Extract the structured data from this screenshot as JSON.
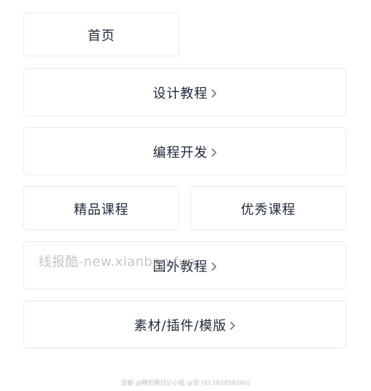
{
  "menu": {
    "home": "首页",
    "design_tutorial": "设计教程",
    "programming_dev": "编程开发",
    "premium_courses": "精品课程",
    "excellent_courses": "优秀课程",
    "foreign_tutorial": "国外教程",
    "materials_plugins_templates": "素材/插件/模版"
  },
  "watermark": {
    "text": "线报酷-new.xianbao.fun"
  },
  "footer": {
    "text": "豆瓣 @瞎折腾日记小组 @豆 [ID:162856260]"
  },
  "icons": {
    "submenu_indicator": "chevron-right-icon"
  },
  "colors": {
    "text": "#1f2a3a",
    "border": "#e6e8eb",
    "chevron": "#7d8591"
  }
}
